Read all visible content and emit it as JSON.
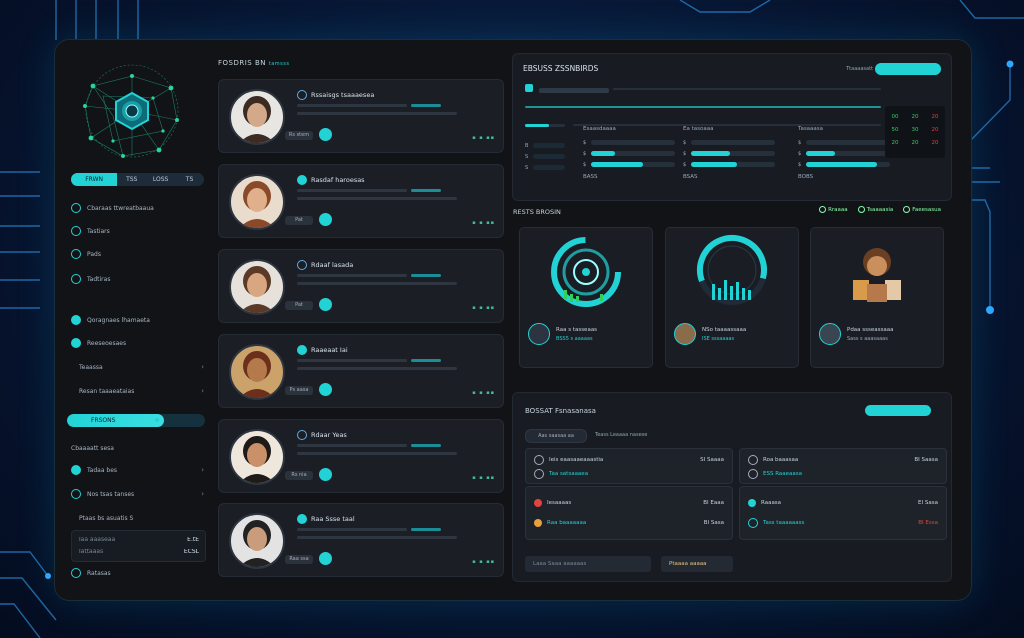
{
  "colors": {
    "accent": "#22d3d6",
    "panel": "#181c22",
    "app_bg": "#111317",
    "positive": "#2fd15c",
    "negative": "#e2433f",
    "warning": "#e9a13b"
  },
  "sidebar": {
    "view_toggle": [
      "FRWN",
      "TSS",
      "LOSS",
      "TS"
    ],
    "group1": [
      {
        "label": "Cbaraas ttwreatbaaua",
        "icon": "hexagon-icon"
      },
      {
        "label": "Tastiars",
        "icon": "user-icon"
      },
      {
        "label": "Pads",
        "icon": "dashboard-icon"
      },
      {
        "label": "Tadtiras",
        "icon": "chart-icon"
      }
    ],
    "group2": [
      {
        "label": "Qoragnaes lhamaeta",
        "icon": "globe-icon"
      },
      {
        "label": "Reeseoesaes",
        "icon": "shield-icon"
      },
      {
        "label": "Teaassa",
        "icon": "folder-icon"
      },
      {
        "label": "Resan taaaeataias",
        "icon": "settings-icon"
      }
    ],
    "progress": {
      "label": "FRSONS",
      "value": 0.7
    },
    "group3_title": "Cbaaaatt sesa",
    "group3": [
      {
        "label": "Tadaa bes",
        "icon": "globe-icon"
      },
      {
        "label": "Nos tsas tanses",
        "icon": "user-icon"
      },
      {
        "label": "Ptaas bs asuatis S",
        "icon": "key-icon"
      }
    ],
    "box": {
      "row1": "Taa aaaseaa",
      "row1_val": "E.tE",
      "row2": "Tattaaas",
      "row2_val": "ECSL"
    },
    "footer_label": "Ratasas"
  },
  "people": {
    "title": "FOSDRIS BN",
    "title_suffix": "tamsss",
    "cards": [
      {
        "name": "Rssaisgs tsaaaesea",
        "btn": "Rs stem",
        "meta": "▪ ▪ ▪▪"
      },
      {
        "name": "Rasdaf haroesas",
        "btn": "Pat",
        "meta": "▪ ▪ ▪▪"
      },
      {
        "name": "Rdaaf lasada",
        "btn": "Pat",
        "meta": "▪ ▪ ▪▪"
      },
      {
        "name": "Raaeaat  Iai",
        "btn": "Ps aasa",
        "meta": "▪ ▪ ▪▪"
      },
      {
        "name": "Rdaar Yeas",
        "btn": "Rs nia",
        "meta": "▪ ▪ ▪▪"
      },
      {
        "name": "Raa Ssse taal",
        "btn": "Raa ssa",
        "meta": "▪ ▪ ▪▪"
      }
    ]
  },
  "metrics": {
    "title": "EBSUSS ZSSNBIRDS",
    "right_label": "Ttaaaasatt",
    "cols": [
      {
        "head": "Esaasdaaaa",
        "bars": [
          0.0,
          0.28,
          0.62
        ],
        "foot": "BASS"
      },
      {
        "head": "Ea tasoaaa",
        "bars": [
          0.0,
          0.47,
          0.55
        ],
        "foot": "BSAS"
      },
      {
        "head": "Tasaaasa",
        "bars": [
          0.0,
          0.35,
          0.85
        ],
        "foot": "BOBS"
      }
    ],
    "keys": [
      "B",
      "S",
      "S"
    ],
    "table": [
      [
        "00",
        "20",
        "20"
      ],
      [
        "50",
        "30",
        "20"
      ],
      [
        "20",
        "20",
        "20"
      ]
    ]
  },
  "visuals": {
    "title": "RESTS BROSIN",
    "tags": [
      "Rraaaa",
      "Tsaaaasia",
      "Faeesasua"
    ],
    "cards": [
      {
        "a": "Raa s  tasseaas",
        "b": "BSS5 s aaaaas"
      },
      {
        "a": "NSo taaaassaaa",
        "b": "ISE sssaaaas"
      },
      {
        "a": "Pdaa ssseassaaa",
        "b": "Sass s aaasaaas"
      }
    ]
  },
  "bottom": {
    "title": "BOSSAT Fsnasanasa",
    "chip": "Aas saasaa aa",
    "filter_text": "Teass Leaaaa nasese",
    "left_rows": [
      {
        "t": "Ieis eaasaaeaaastia",
        "v": "SI Saaaa"
      },
      {
        "t": "Taa satsaaaea",
        "v": ""
      },
      {
        "t": "Iesaaaas",
        "v": "BI Eaaa"
      },
      {
        "t": "Raa baaaaaaa",
        "v": "BI Sasa"
      }
    ],
    "right_rows": [
      {
        "t": "Roa baaasaa",
        "v": "BI Saasa"
      },
      {
        "t": "ESS Raaeaasa",
        "v": ""
      },
      {
        "t": "Raaasa",
        "v": "EI Sasa"
      },
      {
        "t": "Tass taaaaaass",
        "v": "BI Essa"
      }
    ],
    "chip_left": "Laaa  Saaa aaaaaas",
    "chip_right": "Ptaaaa aaaaa"
  }
}
